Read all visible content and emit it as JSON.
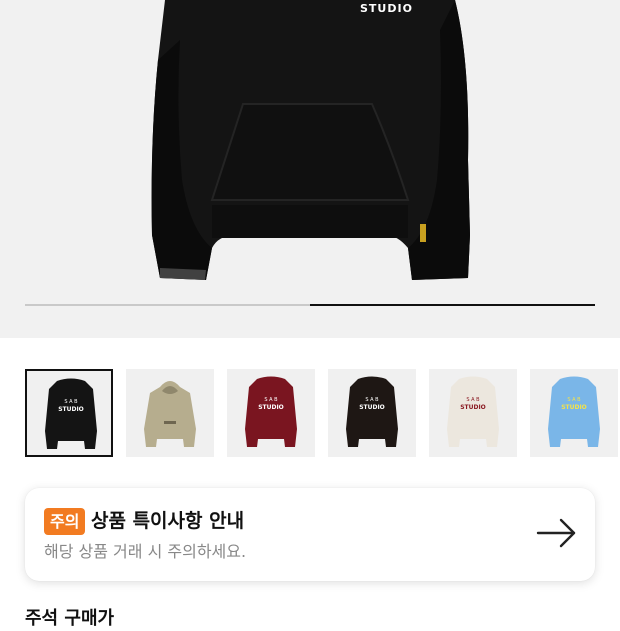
{
  "product_images": {
    "current_image": "black-hoodie-back",
    "hero_print_text": "STUDIO",
    "carousel_progress": 0.5
  },
  "thumbnails": [
    {
      "color": "black",
      "print": "S A B STUDIO",
      "selected": true
    },
    {
      "color": "beige",
      "print": "",
      "selected": false
    },
    {
      "color": "burgundy",
      "print": "S A B STUDIO",
      "selected": false
    },
    {
      "color": "dark-brown",
      "print": "S A B STUDIO",
      "selected": false
    },
    {
      "color": "cream",
      "print": "S A B STUDIO",
      "selected": false
    },
    {
      "color": "sky-blue",
      "print": "S A B STUDIO",
      "selected": false
    }
  ],
  "notice": {
    "badge": "주의",
    "title": "상품 특이사항 안내",
    "description": "해당 상품 거래 시 주의하세요.",
    "arrow_icon": "arrow-right-icon",
    "badge_color": "#f27b21"
  },
  "next_section_title": "주석 구매가"
}
